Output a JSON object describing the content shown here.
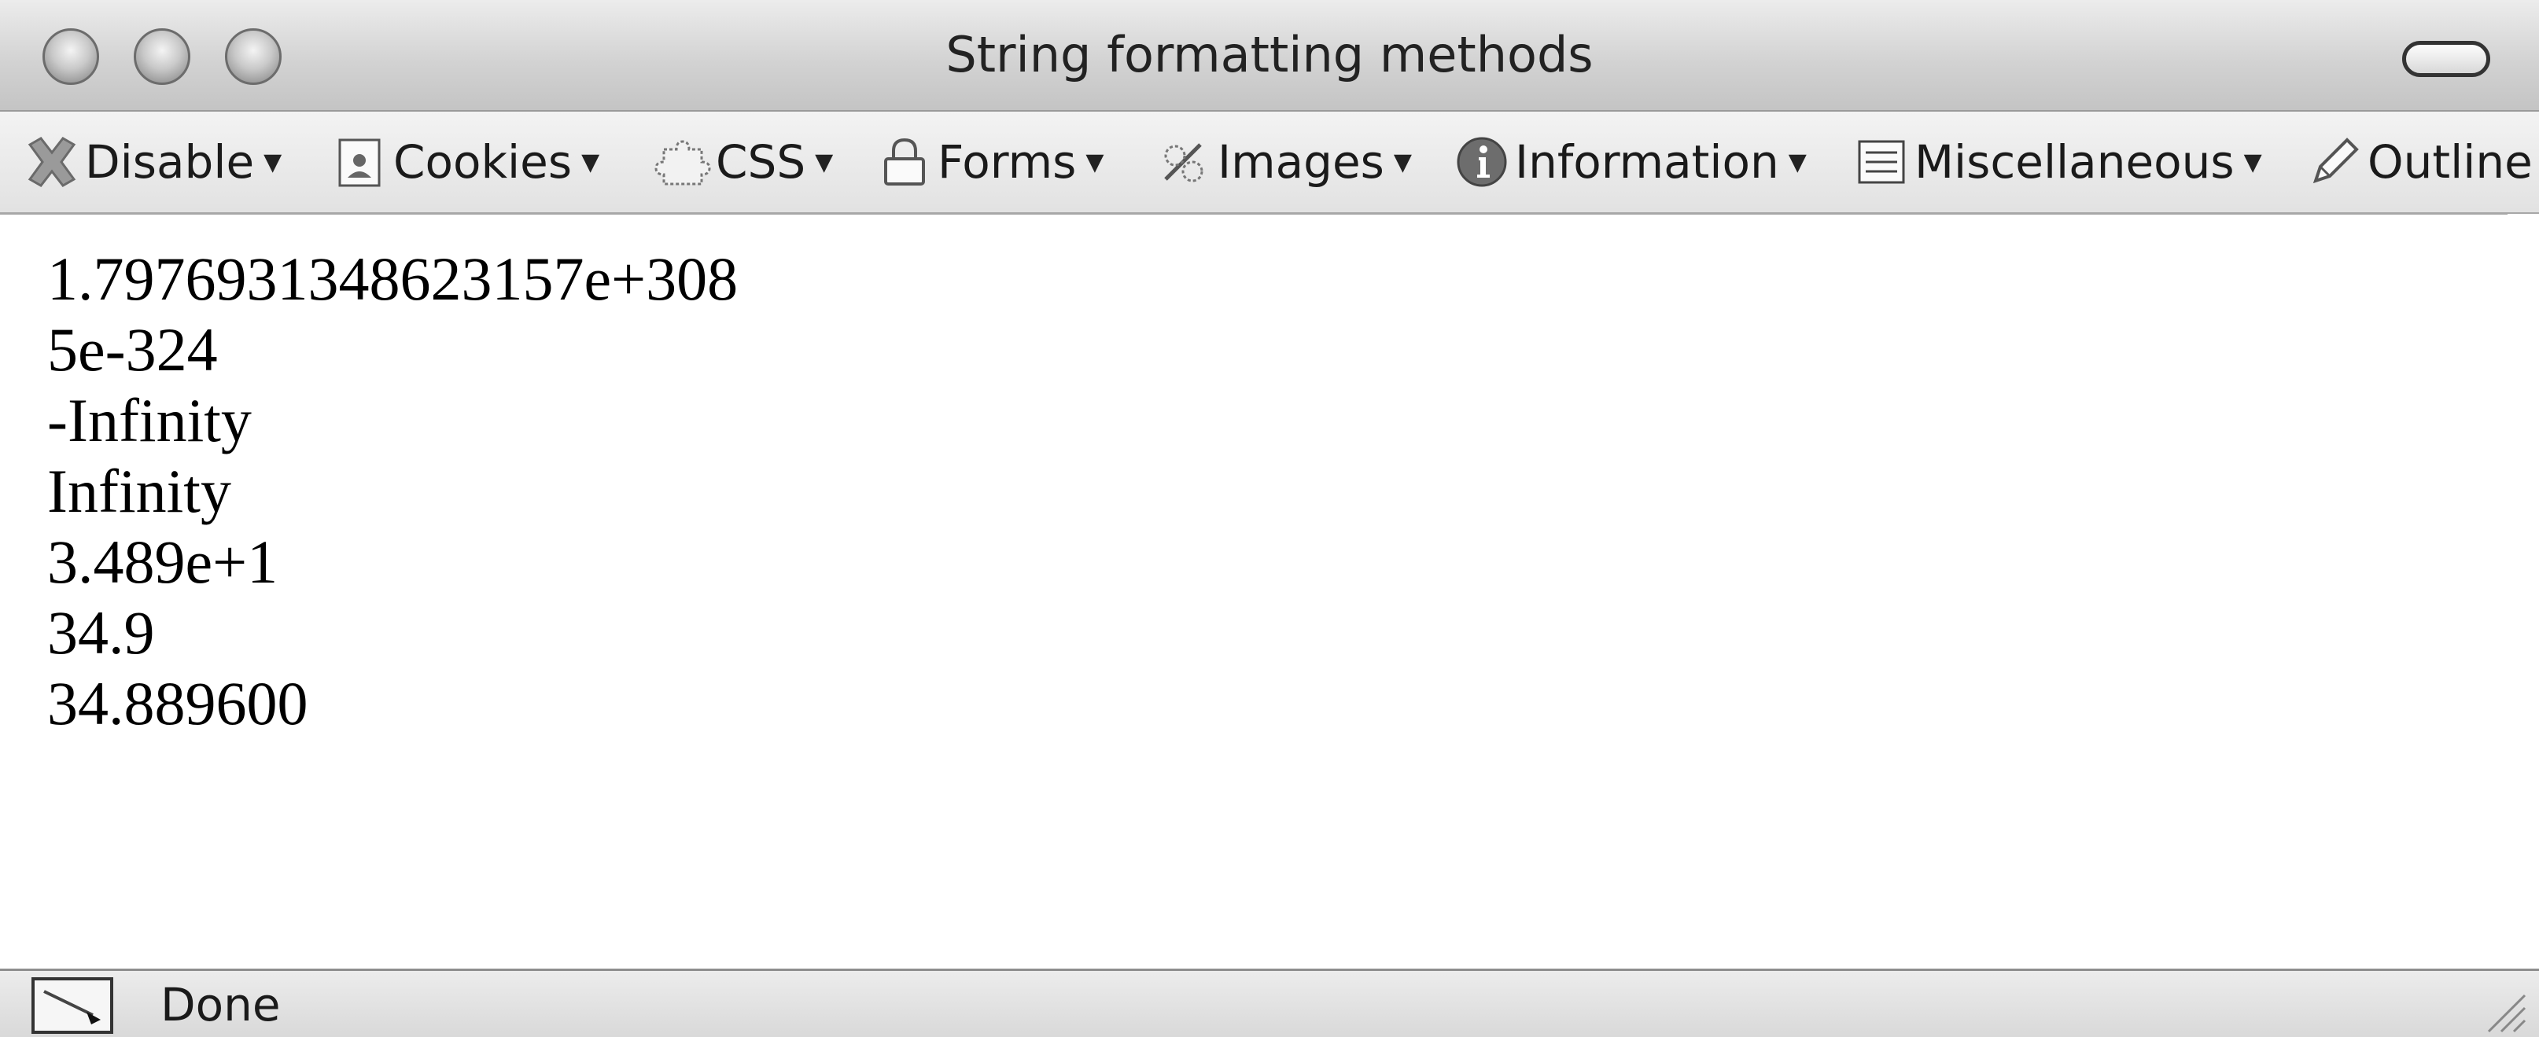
{
  "window": {
    "title": "String formatting methods"
  },
  "toolbar": {
    "menus": [
      {
        "label": "Disable",
        "icon": "disable-x-icon"
      },
      {
        "label": "Cookies",
        "icon": "cookies-icon"
      },
      {
        "label": "CSS",
        "icon": "css-puzzle-icon"
      },
      {
        "label": "Forms",
        "icon": "forms-lock-icon"
      },
      {
        "label": "Images",
        "icon": "images-icon"
      },
      {
        "label": "Information",
        "icon": "information-icon"
      },
      {
        "label": "Miscellaneous",
        "icon": "miscellaneous-list-icon"
      },
      {
        "label": "Outline",
        "icon": "outline-pencil-icon"
      }
    ]
  },
  "content": {
    "lines": [
      "1.7976931348623157e+308",
      "5e-324",
      "-Infinity",
      "Infinity",
      "3.489e+1",
      "34.9",
      "34.889600"
    ]
  },
  "status": {
    "text": "Done",
    "icon": "status-wand-icon"
  }
}
